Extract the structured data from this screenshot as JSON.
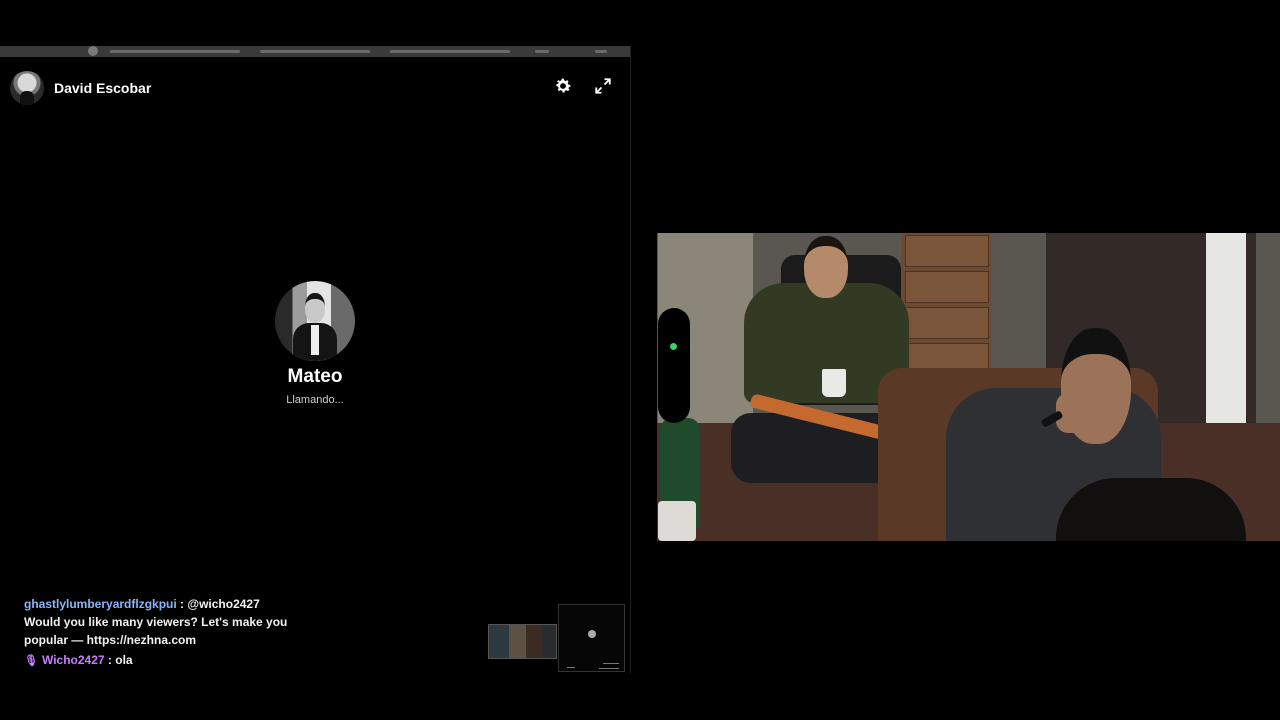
{
  "call": {
    "header_name": "David Escobar",
    "callee_name": "Mateo",
    "status": "Llamando..."
  },
  "icons": {
    "settings": "gear-icon",
    "fullscreen": "expand-icon",
    "mic": "microphone-icon"
  },
  "chat": {
    "messages": [
      {
        "user": "ghastlylumberyardflzgkpui",
        "text": ": @wicho2427 Would you like many viewers? Let's make you popular — https://nezhna.com"
      },
      {
        "user": "Wicho2427",
        "text": ": ola"
      }
    ]
  },
  "colors": {
    "background": "#000000",
    "chat_user_primary": "#8ab4f8",
    "chat_user_secondary": "#c77dff",
    "indicator_green": "#3bd16f"
  }
}
